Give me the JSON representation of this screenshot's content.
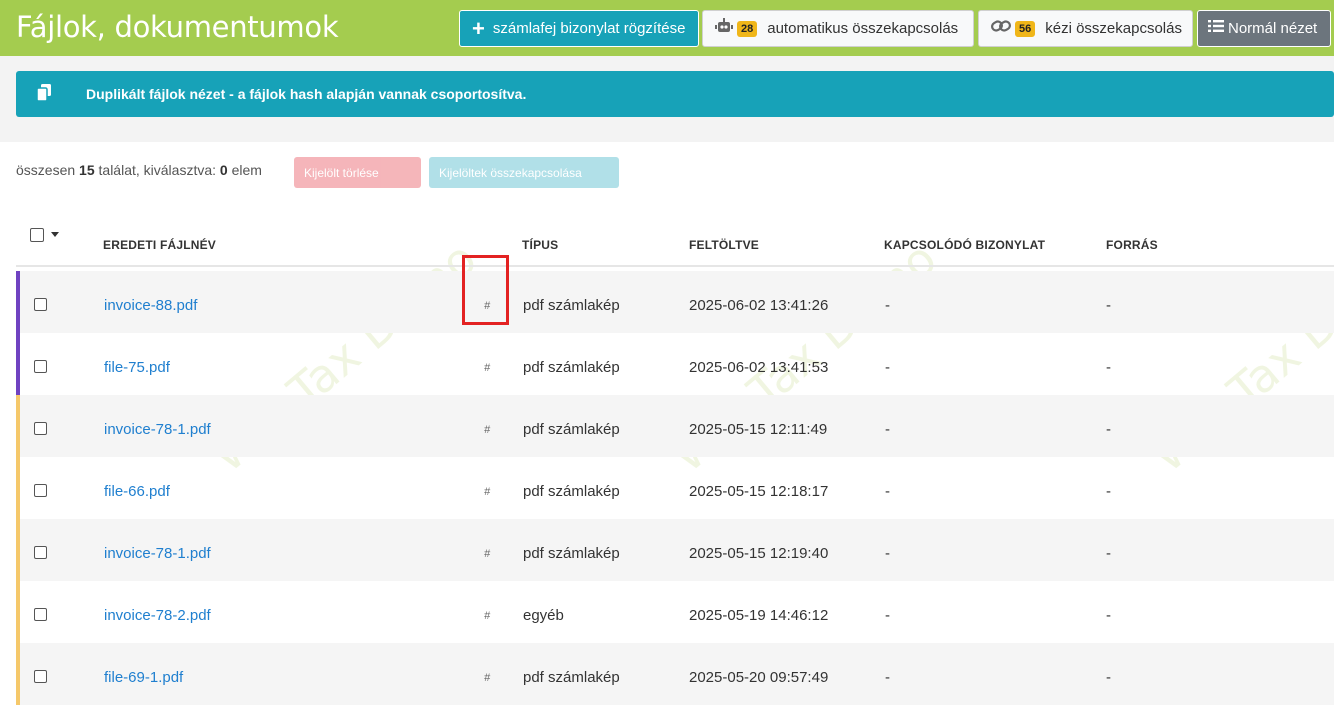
{
  "header": {
    "title": "Fájlok, dokumentumok",
    "add_button": "számlafej bizonylat rögzítése",
    "auto_link_count": "28",
    "auto_link_label": "automatikus összekapcsolás",
    "manual_link_count": "56",
    "manual_link_label": "kézi összekapcsolás",
    "normal_view_label": "Normál nézet"
  },
  "alert": {
    "text": "Duplikált fájlok nézet - a fájlok hash alapján vannak csoportosítva."
  },
  "summary": {
    "prefix": "összesen",
    "total": "15",
    "middle": "találat, kiválasztva:",
    "selected": "0",
    "suffix": "elem"
  },
  "actions": {
    "delete_label": "Kijelölt törlése",
    "link_label": "Kijelöltek összekapcsolása"
  },
  "watermark": "WebTax Demo",
  "table": {
    "columns": {
      "filename": "EREDETI FÁJLNÉV",
      "type": "TÍPUS",
      "uploaded": "FELTÖLTVE",
      "related": "KAPCSOLÓDÓ BIZONYLAT",
      "source": "FORRÁS"
    },
    "rows": [
      {
        "filename": "invoice-88.pdf",
        "hash": "#",
        "type": "pdf számlakép",
        "uploaded": "2025-06-02 13:41:26",
        "related": "-",
        "source": "-",
        "group_color": "#6f42c1"
      },
      {
        "filename": "file-75.pdf",
        "hash": "#",
        "type": "pdf számlakép",
        "uploaded": "2025-06-02 13:41:53",
        "related": "-",
        "source": "-",
        "group_color": "#6f42c1"
      },
      {
        "filename": "invoice-78-1.pdf",
        "hash": "#",
        "type": "pdf számlakép",
        "uploaded": "2025-05-15 12:11:49",
        "related": "-",
        "source": "-",
        "group_color": "#f5c86a"
      },
      {
        "filename": "file-66.pdf",
        "hash": "#",
        "type": "pdf számlakép",
        "uploaded": "2025-05-15 12:18:17",
        "related": "-",
        "source": "-",
        "group_color": "#f5c86a"
      },
      {
        "filename": "invoice-78-1.pdf",
        "hash": "#",
        "type": "pdf számlakép",
        "uploaded": "2025-05-15 12:19:40",
        "related": "-",
        "source": "-",
        "group_color": "#f5c86a"
      },
      {
        "filename": "invoice-78-2.pdf",
        "hash": "#",
        "type": "egyéb",
        "uploaded": "2025-05-19 14:46:12",
        "related": "-",
        "source": "-",
        "group_color": "#f5c86a"
      },
      {
        "filename": "file-69-1.pdf",
        "hash": "#",
        "type": "pdf számlakép",
        "uploaded": "2025-05-20 09:57:49",
        "related": "-",
        "source": "-",
        "group_color": "#f5c86a"
      }
    ]
  },
  "icons": {
    "add": "plus-icon",
    "auto": "robot-icon",
    "manual": "link-icon",
    "normal": "list-icon",
    "alert": "copy-icon"
  },
  "colors": {
    "header_bg": "#a4cc4f",
    "accent": "#17a2b8",
    "badge": "#f0b619",
    "link": "#1f7fcf"
  }
}
